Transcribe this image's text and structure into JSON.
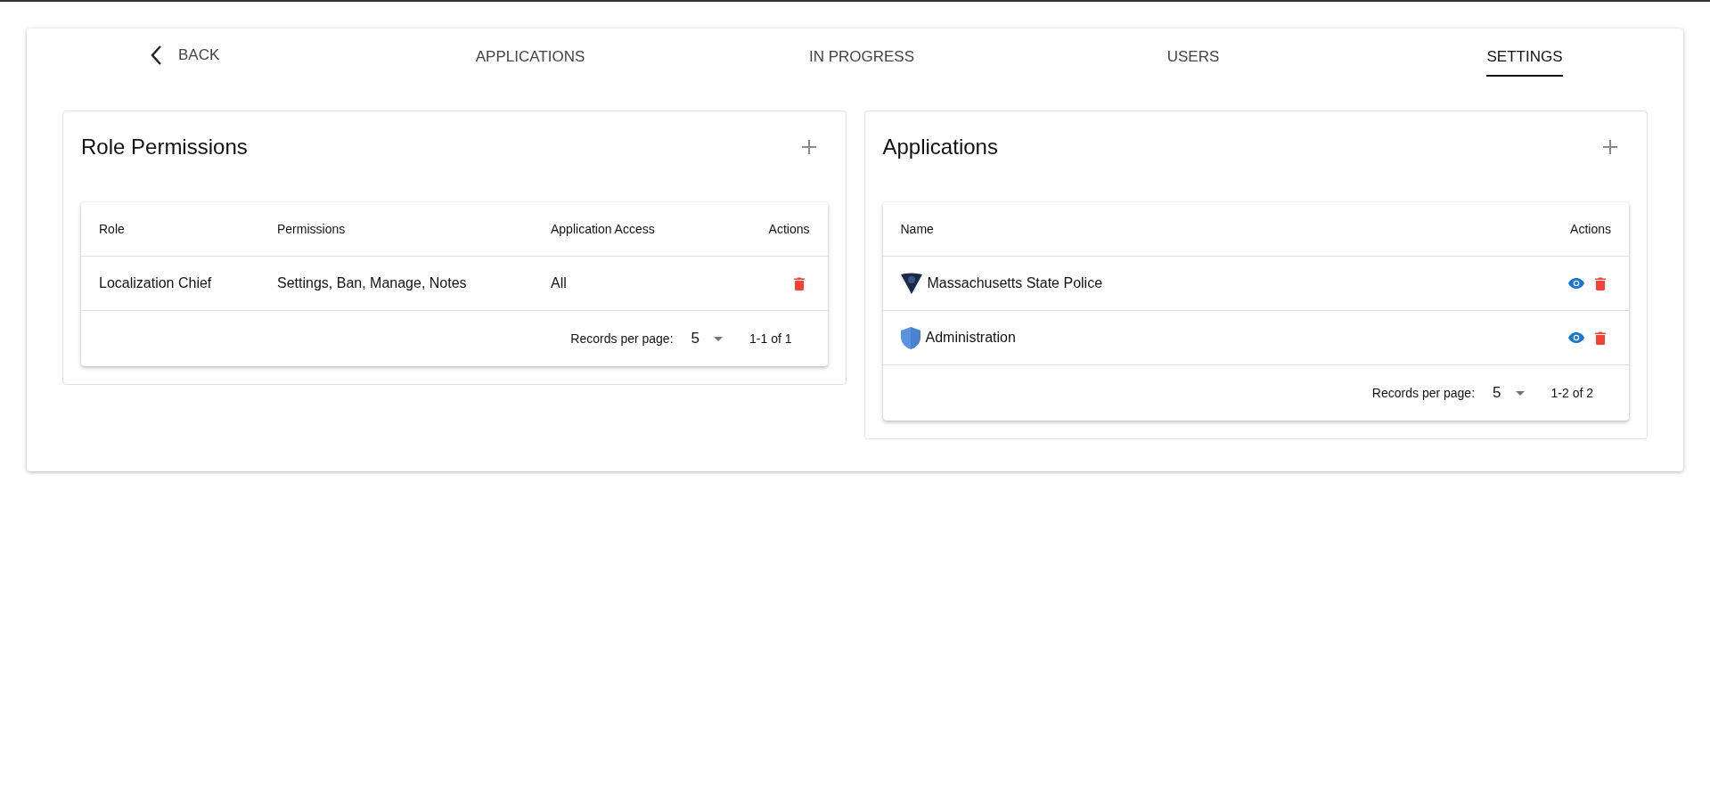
{
  "nav": {
    "back": {
      "label": "BACK"
    },
    "tabs": [
      {
        "label": "APPLICATIONS",
        "selected": false
      },
      {
        "label": "IN PROGRESS",
        "selected": false
      },
      {
        "label": "USERS",
        "selected": false
      },
      {
        "label": "SETTINGS",
        "selected": true
      }
    ]
  },
  "role_permissions": {
    "title": "Role Permissions",
    "columns": [
      "Role",
      "Permissions",
      "Application Access",
      "Actions"
    ],
    "rows": [
      {
        "role": "Localization Chief",
        "permissions": "Settings, Ban, Manage, Notes",
        "application_access": "All"
      }
    ],
    "records_per_page_label": "Records per page:",
    "records_per_page": "5",
    "range": "1-1 of 1"
  },
  "applications": {
    "title": "Applications",
    "columns": [
      "Name",
      "Actions"
    ],
    "rows": [
      {
        "name": "Massachusetts State Police",
        "kind": "badge"
      },
      {
        "name": "Administration",
        "kind": "shield"
      }
    ],
    "records_per_page_label": "Records per page:",
    "records_per_page": "5",
    "range": "1-2 of 2"
  }
}
